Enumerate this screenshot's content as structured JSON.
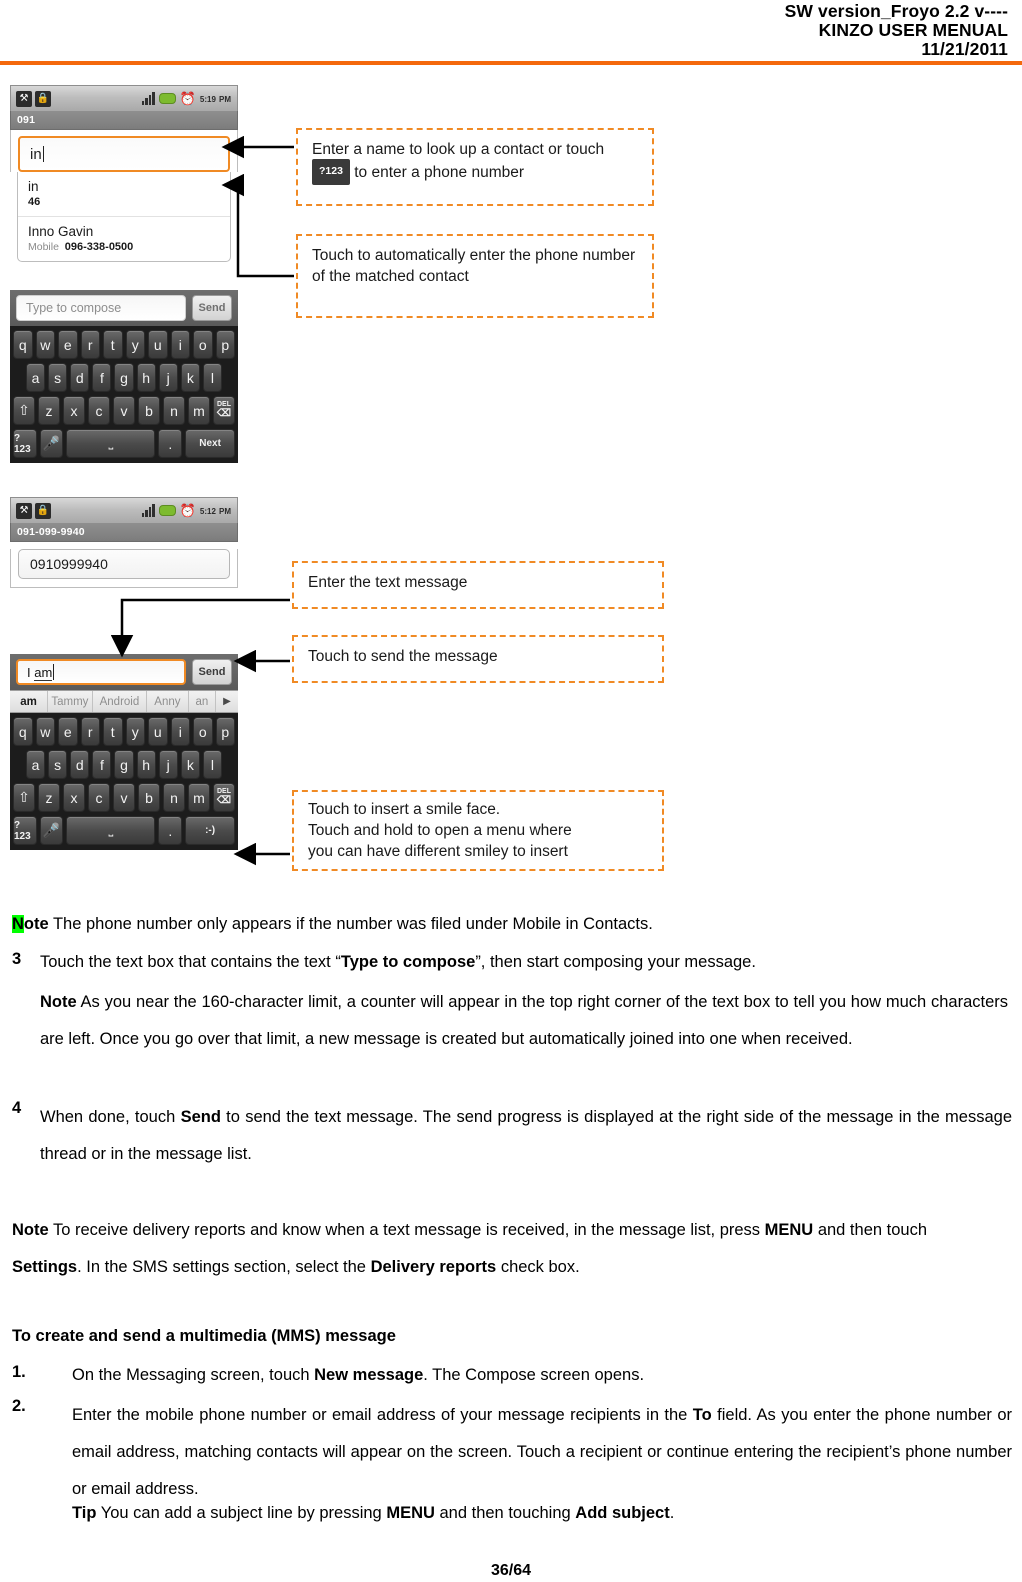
{
  "header": {
    "line1": "SW version_Froyo 2.2 v----",
    "line2": "KINZO USER MENUAL",
    "line3": "11/21/2011",
    "rule_color": "#F4680C"
  },
  "phone1": {
    "status": {
      "usb_icon": "usb-icon",
      "lock_icon": "lock-icon",
      "signal_icon": "signal-bars-icon",
      "battery_icon": "battery-icon",
      "alarm_icon": "alarm-clock-icon",
      "time": "5:19",
      "meridiem": "PM"
    },
    "title": "091",
    "to_field_value": "in",
    "suggestions": [
      {
        "main": "in",
        "sub_label": "",
        "sub_value": "46"
      },
      {
        "main": "Inno Gavin",
        "sub_label": "Mobile",
        "sub_value": "096-338-0500"
      }
    ],
    "compose_placeholder": "Type to compose",
    "send_label": "Send",
    "keyboard": {
      "row1": [
        "q",
        "w",
        "e",
        "r",
        "t",
        "y",
        "u",
        "i",
        "o",
        "p"
      ],
      "row2": [
        "a",
        "s",
        "d",
        "f",
        "g",
        "h",
        "j",
        "k",
        "l"
      ],
      "row3": [
        "z",
        "x",
        "c",
        "v",
        "b",
        "n",
        "m"
      ],
      "shift_label": "shift-key",
      "delete_label": "DEL",
      "symbols_label": "?123",
      "mic_label": "mic-key",
      "space_label": "space-key",
      "period_label": ".",
      "enter_label": "Next"
    }
  },
  "phone2": {
    "status": {
      "time": "5:12",
      "meridiem": "PM"
    },
    "title": "091-099-9940",
    "recipient_value": "0910999940",
    "compose_value": "I am",
    "send_label": "Send",
    "suggestion_strip": [
      "am",
      "Tammy",
      "Android",
      "Anny",
      "an"
    ],
    "strip_arrow": "▶",
    "keyboard": {
      "row1": [
        "q",
        "w",
        "e",
        "r",
        "t",
        "y",
        "u",
        "i",
        "o",
        "p"
      ],
      "row2": [
        "a",
        "s",
        "d",
        "f",
        "g",
        "h",
        "j",
        "k",
        "l"
      ],
      "row3": [
        "z",
        "x",
        "c",
        "v",
        "b",
        "n",
        "m"
      ],
      "delete_label": "DEL",
      "symbols_label": "?123",
      "period_label": ".",
      "smiley_label": ":-)"
    }
  },
  "callouts": {
    "c1_part1": "Enter a name to look up a contact or touch",
    "c1_key": "?123",
    "c1_part2": "to enter a phone number",
    "c2": "Touch to automatically enter the phone number of the matched contact",
    "c3": "Enter the text message",
    "c4": "Touch to send the message",
    "c5_line1": "Touch to insert a smile face.",
    "c5_line2": "Touch and hold to open a menu where",
    "c5_line3": "you can have different smiley to insert"
  },
  "body": {
    "note1_label": "Note",
    "note1_label_first": "N",
    "note1_label_rest": "ote",
    "note1_text": " The phone number only appears if the number was filed under Mobile in Contacts.",
    "step3_num": "3",
    "step3_a": "Touch the text box that contains the text “",
    "step3_bold": "Type to compose",
    "step3_b": "”, then start composing your message.",
    "note2_label": "Note",
    "note2_text": " As you near the 160-character limit, a counter will appear in the top right corner of the text box to tell you how much characters are left. Once you go over that limit, a new message is created but automatically joined into one when received.",
    "step4_num": "4",
    "step4_a": "When done, touch ",
    "step4_bold": "Send",
    "step4_b": " to send the text message. The send progress is displayed at the right side of the message in the message thread or in the message list.",
    "note3_label": "Note",
    "note3_a": " To receive delivery reports and know when a text message is received, in the message list, press ",
    "note3_bold1": "MENU",
    "note3_b": " and then touch ",
    "note3_bold2": "Settings",
    "note3_c": ". In the SMS settings section, select the ",
    "note3_bold3": "Delivery reports",
    "note3_d": " check box.",
    "mms_heading": "To create and send a multimedia (MMS) message",
    "mms1_num": "1.",
    "mms1_a": "On the Messaging screen, touch ",
    "mms1_bold": "New message",
    "mms1_b": ". The Compose screen opens.",
    "mms2_num": "2.",
    "mms2_a": "Enter the mobile phone number or email address of your message recipients in the ",
    "mms2_bold": "To",
    "mms2_b": " field. As you enter the phone number or email address, matching contacts will appear on the screen. Touch a recipient or continue entering the recipient’s phone number or email address.",
    "tip_label": "Tip",
    "tip_a": " You can add a subject line by pressing ",
    "tip_bold1": "MENU",
    "tip_b": " and then touching ",
    "tip_bold2": "Add subject",
    "tip_c": ".",
    "page_number": "36/64"
  }
}
